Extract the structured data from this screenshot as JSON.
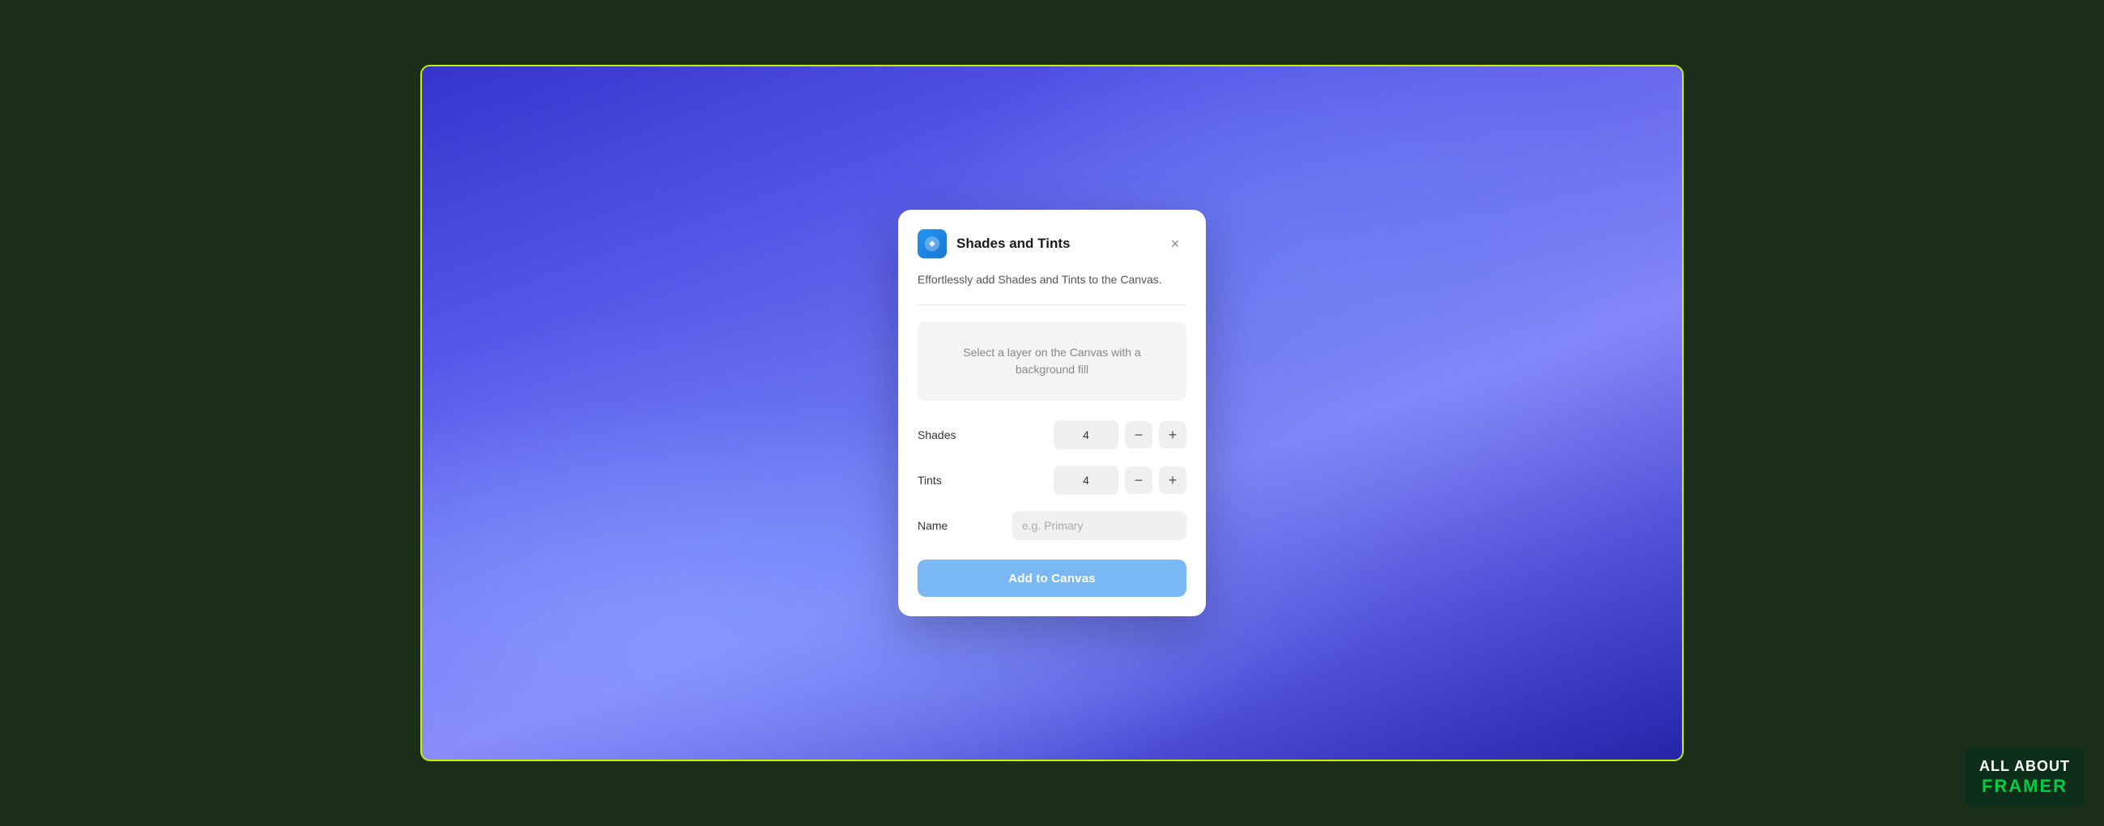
{
  "canvas": {
    "border_color": "#c8f000"
  },
  "modal": {
    "title": "Shades and Tints",
    "description": "Effortlessly add Shades and Tints to the Canvas.",
    "close_label": "×",
    "select_layer_text": "Select a layer on the Canvas with a background fill",
    "shades_label": "Shades",
    "shades_value": "4",
    "tints_label": "Tints",
    "tints_value": "4",
    "name_label": "Name",
    "name_placeholder": "e.g. Primary",
    "add_to_canvas_label": "Add to Canvas",
    "minus_label": "−",
    "plus_label": "+"
  },
  "branding": {
    "line1": "ALL ABOUT",
    "line2": "FRAMER"
  }
}
